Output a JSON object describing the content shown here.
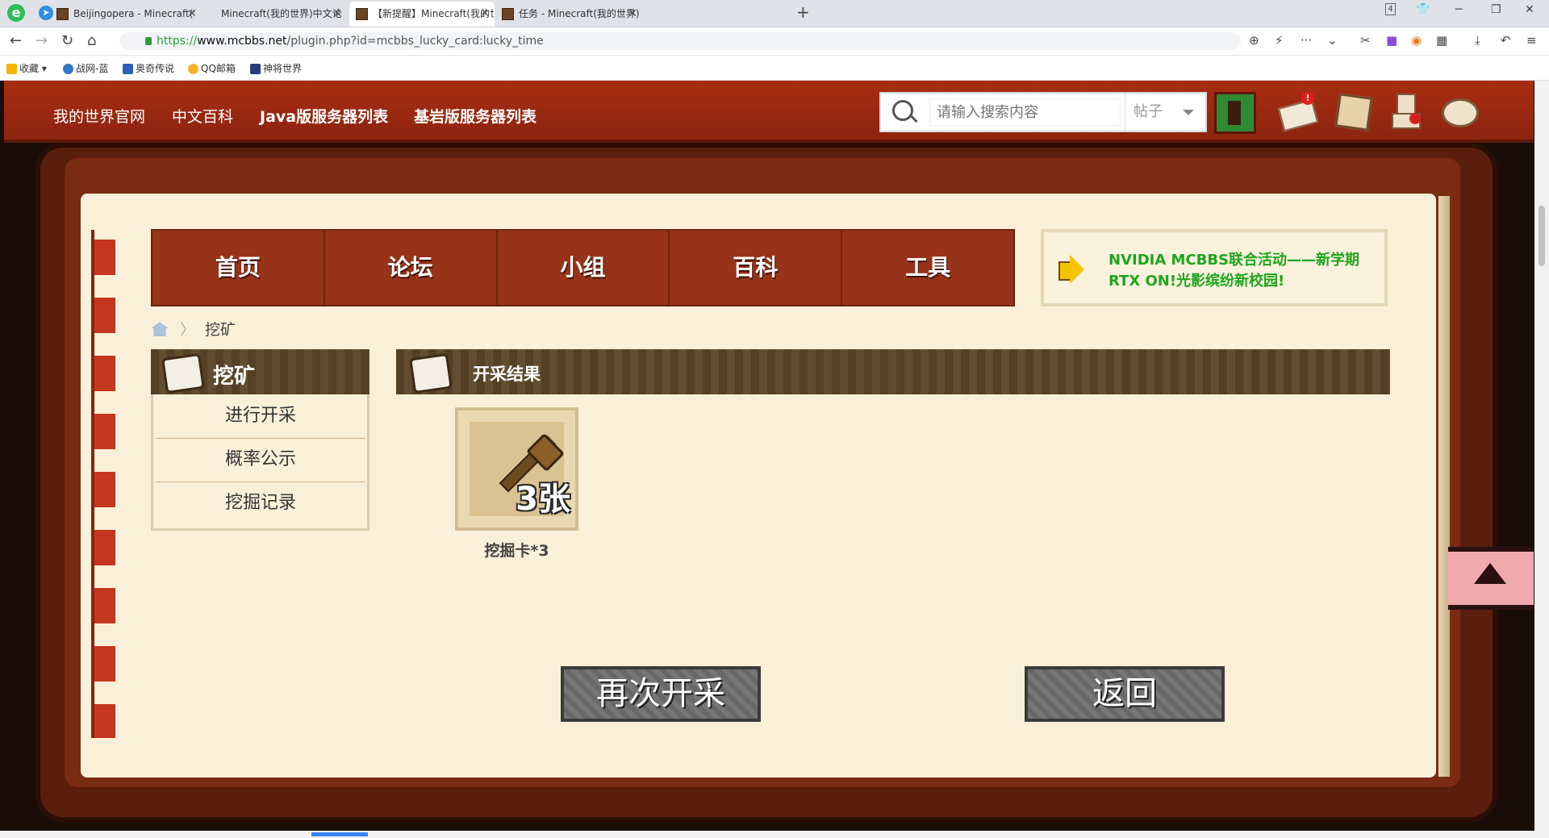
{
  "browser": {
    "tabs": [
      {
        "title": "Beijingopera - Minecraft(我"
      },
      {
        "title": "Minecraft(我的世界)中文论坛"
      },
      {
        "title": "【新提醒】Minecraft(我的世"
      },
      {
        "title": "任务 - Minecraft(我的世界)中"
      }
    ],
    "url_scheme": "https://",
    "url_host": "www.mcbbs.net",
    "url_path": "/plugin.php?id=mcbbs_lucky_card:lucky_time",
    "tab_count": "4",
    "bookmarks": [
      "收藏",
      "战网-蓝",
      "奥奇传说",
      "QQ邮箱",
      "神将世界"
    ]
  },
  "site": {
    "nav": [
      "我的世界官网",
      "中文百科",
      "Java版服务器列表",
      "基岩版服务器列表"
    ],
    "search_placeholder": "请输入搜索内容",
    "search_type": "帖子",
    "mail_badge": "!"
  },
  "main_nav": [
    "首页",
    "论坛",
    "小组",
    "百科",
    "工具"
  ],
  "announcement": "NVIDIA MCBBS联合活动——新学期RTX ON!光影缤纷新校园!",
  "breadcrumb": "挖矿",
  "sidebar": {
    "title": "挖矿",
    "items": [
      "进行开采",
      "概率公示",
      "挖掘记录"
    ]
  },
  "result": {
    "title": "开采结果",
    "card_count": "3张",
    "card_label": "挖掘卡*3"
  },
  "buttons": {
    "again": "再次开采",
    "back": "返回"
  },
  "colors": {
    "header_red": "#a92d12",
    "nav_red": "#973318",
    "paper": "#faf0d9",
    "announce_green": "#1ea61e"
  }
}
